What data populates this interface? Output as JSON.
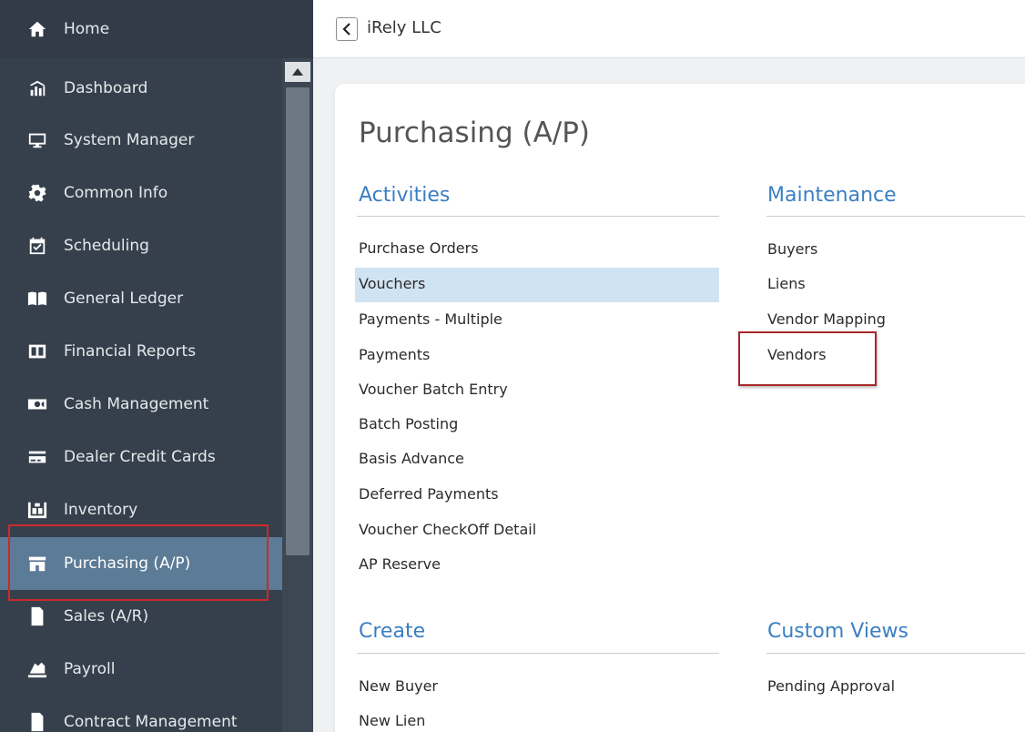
{
  "sidebar": {
    "home": {
      "label": "Home",
      "icon": "home-icon"
    },
    "items": [
      {
        "label": "Dashboard",
        "icon": "dashboard-icon"
      },
      {
        "label": "System Manager",
        "icon": "monitor-icon"
      },
      {
        "label": "Common Info",
        "icon": "gear-icon"
      },
      {
        "label": "Scheduling",
        "icon": "calendar-check-icon"
      },
      {
        "label": "General Ledger",
        "icon": "book-icon"
      },
      {
        "label": "Financial Reports",
        "icon": "columns-icon"
      },
      {
        "label": "Cash Management",
        "icon": "money-icon"
      },
      {
        "label": "Dealer Credit Cards",
        "icon": "credit-card-icon"
      },
      {
        "label": "Inventory",
        "icon": "warehouse-icon"
      },
      {
        "label": "Purchasing (A/P)",
        "icon": "store-icon",
        "active": true
      },
      {
        "label": "Sales (A/R)",
        "icon": "document-icon"
      },
      {
        "label": "Payroll",
        "icon": "payroll-icon"
      },
      {
        "label": "Contract Management",
        "icon": "contract-icon"
      }
    ]
  },
  "header": {
    "company": "iRely LLC"
  },
  "page": {
    "title": "Purchasing (A/P)",
    "activities": {
      "title": "Activities",
      "links": [
        "Purchase Orders",
        "Vouchers",
        "Payments - Multiple",
        "Payments",
        "Voucher Batch Entry",
        "Batch Posting",
        "Basis Advance",
        "Deferred Payments",
        "Voucher CheckOff Detail",
        "AP Reserve"
      ]
    },
    "maintenance": {
      "title": "Maintenance",
      "links": [
        "Buyers",
        "Liens",
        "Vendor Mapping",
        "Vendors"
      ]
    },
    "create": {
      "title": "Create",
      "links": [
        "New Buyer",
        "New Lien"
      ]
    },
    "custom_views": {
      "title": "Custom Views",
      "links": [
        "Pending Approval"
      ]
    }
  },
  "colors": {
    "sidebar_bg": "#36404c",
    "active_item": "#5c7b96",
    "section_title": "#3b7fc1",
    "hover_row": "#d0e3f2",
    "highlight_border": "#cc2a2a"
  }
}
